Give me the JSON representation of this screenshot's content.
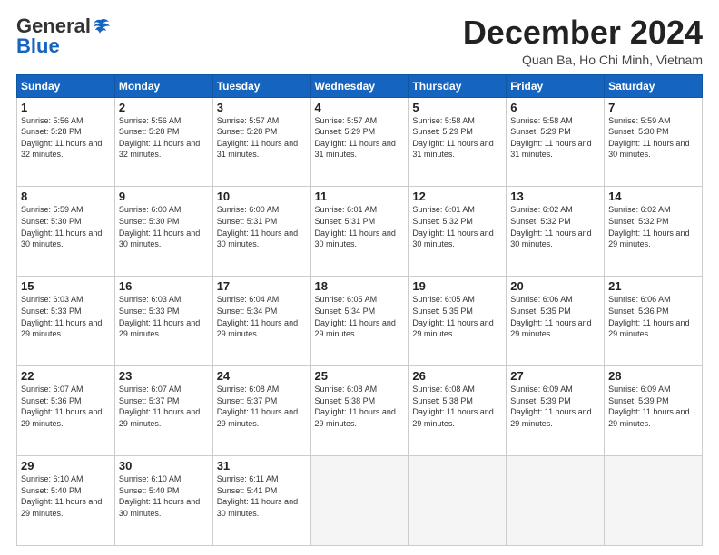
{
  "logo": {
    "general": "General",
    "blue": "Blue"
  },
  "title": "December 2024",
  "subtitle": "Quan Ba, Ho Chi Minh, Vietnam",
  "days_header": [
    "Sunday",
    "Monday",
    "Tuesday",
    "Wednesday",
    "Thursday",
    "Friday",
    "Saturday"
  ],
  "weeks": [
    [
      {
        "day": "1",
        "sunrise": "5:56 AM",
        "sunset": "5:28 PM",
        "daylight": "11 hours and 32 minutes."
      },
      {
        "day": "2",
        "sunrise": "5:56 AM",
        "sunset": "5:28 PM",
        "daylight": "11 hours and 32 minutes."
      },
      {
        "day": "3",
        "sunrise": "5:57 AM",
        "sunset": "5:28 PM",
        "daylight": "11 hours and 31 minutes."
      },
      {
        "day": "4",
        "sunrise": "5:57 AM",
        "sunset": "5:29 PM",
        "daylight": "11 hours and 31 minutes."
      },
      {
        "day": "5",
        "sunrise": "5:58 AM",
        "sunset": "5:29 PM",
        "daylight": "11 hours and 31 minutes."
      },
      {
        "day": "6",
        "sunrise": "5:58 AM",
        "sunset": "5:29 PM",
        "daylight": "11 hours and 31 minutes."
      },
      {
        "day": "7",
        "sunrise": "5:59 AM",
        "sunset": "5:30 PM",
        "daylight": "11 hours and 30 minutes."
      }
    ],
    [
      {
        "day": "8",
        "sunrise": "5:59 AM",
        "sunset": "5:30 PM",
        "daylight": "11 hours and 30 minutes."
      },
      {
        "day": "9",
        "sunrise": "6:00 AM",
        "sunset": "5:30 PM",
        "daylight": "11 hours and 30 minutes."
      },
      {
        "day": "10",
        "sunrise": "6:00 AM",
        "sunset": "5:31 PM",
        "daylight": "11 hours and 30 minutes."
      },
      {
        "day": "11",
        "sunrise": "6:01 AM",
        "sunset": "5:31 PM",
        "daylight": "11 hours and 30 minutes."
      },
      {
        "day": "12",
        "sunrise": "6:01 AM",
        "sunset": "5:32 PM",
        "daylight": "11 hours and 30 minutes."
      },
      {
        "day": "13",
        "sunrise": "6:02 AM",
        "sunset": "5:32 PM",
        "daylight": "11 hours and 30 minutes."
      },
      {
        "day": "14",
        "sunrise": "6:02 AM",
        "sunset": "5:32 PM",
        "daylight": "11 hours and 29 minutes."
      }
    ],
    [
      {
        "day": "15",
        "sunrise": "6:03 AM",
        "sunset": "5:33 PM",
        "daylight": "11 hours and 29 minutes."
      },
      {
        "day": "16",
        "sunrise": "6:03 AM",
        "sunset": "5:33 PM",
        "daylight": "11 hours and 29 minutes."
      },
      {
        "day": "17",
        "sunrise": "6:04 AM",
        "sunset": "5:34 PM",
        "daylight": "11 hours and 29 minutes."
      },
      {
        "day": "18",
        "sunrise": "6:05 AM",
        "sunset": "5:34 PM",
        "daylight": "11 hours and 29 minutes."
      },
      {
        "day": "19",
        "sunrise": "6:05 AM",
        "sunset": "5:35 PM",
        "daylight": "11 hours and 29 minutes."
      },
      {
        "day": "20",
        "sunrise": "6:06 AM",
        "sunset": "5:35 PM",
        "daylight": "11 hours and 29 minutes."
      },
      {
        "day": "21",
        "sunrise": "6:06 AM",
        "sunset": "5:36 PM",
        "daylight": "11 hours and 29 minutes."
      }
    ],
    [
      {
        "day": "22",
        "sunrise": "6:07 AM",
        "sunset": "5:36 PM",
        "daylight": "11 hours and 29 minutes."
      },
      {
        "day": "23",
        "sunrise": "6:07 AM",
        "sunset": "5:37 PM",
        "daylight": "11 hours and 29 minutes."
      },
      {
        "day": "24",
        "sunrise": "6:08 AM",
        "sunset": "5:37 PM",
        "daylight": "11 hours and 29 minutes."
      },
      {
        "day": "25",
        "sunrise": "6:08 AM",
        "sunset": "5:38 PM",
        "daylight": "11 hours and 29 minutes."
      },
      {
        "day": "26",
        "sunrise": "6:08 AM",
        "sunset": "5:38 PM",
        "daylight": "11 hours and 29 minutes."
      },
      {
        "day": "27",
        "sunrise": "6:09 AM",
        "sunset": "5:39 PM",
        "daylight": "11 hours and 29 minutes."
      },
      {
        "day": "28",
        "sunrise": "6:09 AM",
        "sunset": "5:39 PM",
        "daylight": "11 hours and 29 minutes."
      }
    ],
    [
      {
        "day": "29",
        "sunrise": "6:10 AM",
        "sunset": "5:40 PM",
        "daylight": "11 hours and 29 minutes."
      },
      {
        "day": "30",
        "sunrise": "6:10 AM",
        "sunset": "5:40 PM",
        "daylight": "11 hours and 30 minutes."
      },
      {
        "day": "31",
        "sunrise": "6:11 AM",
        "sunset": "5:41 PM",
        "daylight": "11 hours and 30 minutes."
      },
      null,
      null,
      null,
      null
    ]
  ]
}
